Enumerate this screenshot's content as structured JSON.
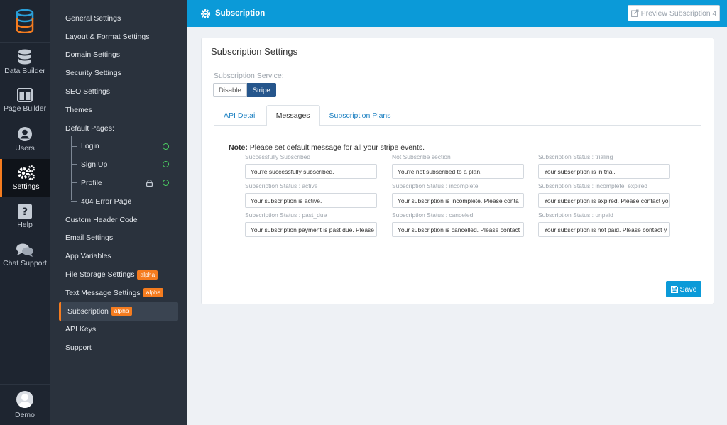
{
  "rail": {
    "logo_icon": "database-stack-logo",
    "items": [
      {
        "label": "Data Builder",
        "icon": "database-icon"
      },
      {
        "label": "Page Builder",
        "icon": "columns-icon"
      },
      {
        "label": "Users",
        "icon": "user-circle-icon"
      },
      {
        "label": "Settings",
        "icon": "gears-icon",
        "active": true
      },
      {
        "label": "Help",
        "icon": "question-icon"
      },
      {
        "label": "Chat Support",
        "icon": "chat-icon"
      }
    ],
    "user": {
      "label": "Demo",
      "icon": "avatar"
    }
  },
  "menu": {
    "items": [
      {
        "label": "General Settings"
      },
      {
        "label": "Layout & Format Settings"
      },
      {
        "label": "Domain Settings"
      },
      {
        "label": "Security Settings"
      },
      {
        "label": "SEO Settings"
      },
      {
        "label": "Themes"
      },
      {
        "label": "Default Pages:"
      },
      {
        "label": "Login",
        "sub": true,
        "status": "ok"
      },
      {
        "label": "Sign Up",
        "sub": true,
        "status": "ok"
      },
      {
        "label": "Profile",
        "sub": true,
        "status": "ok",
        "locked": true
      },
      {
        "label": "404 Error Page",
        "sub": true
      },
      {
        "label": "Custom Header Code"
      },
      {
        "label": "Email Settings"
      },
      {
        "label": "App Variables"
      },
      {
        "label": "File Storage Settings",
        "badge": "alpha"
      },
      {
        "label": "Text Message Settings",
        "badge": "alpha"
      },
      {
        "label": "Subscription",
        "badge": "alpha",
        "active": true
      },
      {
        "label": "API Keys"
      },
      {
        "label": "Support"
      }
    ]
  },
  "topbar": {
    "title": "Subscription",
    "preview_label": "Preview Subscription 4"
  },
  "card": {
    "title": "Subscription Settings",
    "service_label": "Subscription Service:",
    "service_options": [
      "Disable",
      "Stripe"
    ],
    "service_selected": "Stripe",
    "tabs": [
      "API Detail",
      "Messages",
      "Subscription Plans"
    ],
    "active_tab": "Messages",
    "note_bold": "Note:",
    "note_text": " Please set default message for all your stripe events.",
    "fields": [
      {
        "label": "Successfully Subscribed",
        "value": "You're successfully subscribed."
      },
      {
        "label": "Not Subscribe section",
        "value": "You're not subscribed to a plan."
      },
      {
        "label": "Subscription Status : trialing",
        "value": "Your subscription is in trial."
      },
      {
        "label": "Subscription Status : active",
        "value": "Your subscription is active."
      },
      {
        "label": "Subscription Status : incomplete",
        "value": "Your subscription is incomplete. Please conta"
      },
      {
        "label": "Subscription Status : incomplete_expired",
        "value": "Your subscription is expired. Please contact yo"
      },
      {
        "label": "Subscription Status : past_due",
        "value": "Your subscription payment is past due. Please"
      },
      {
        "label": "Subscription Status : canceled",
        "value": "Your subscription is cancelled. Please contact"
      },
      {
        "label": "Subscription Status : unpaid",
        "value": "Your subscription is not paid. Please contact y"
      }
    ],
    "save_label": "Save"
  },
  "colors": {
    "accent": "#0b9ad8",
    "brand_orange": "#f57c1f",
    "sidebar_dark": "#1e2530",
    "menu_bg": "#2a323d",
    "status_green": "#4cd263",
    "selected_segment": "#26568c"
  }
}
